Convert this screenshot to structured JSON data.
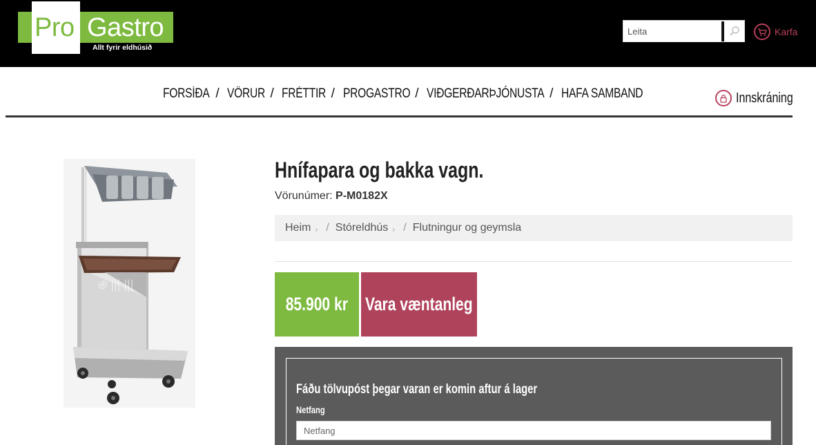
{
  "header": {
    "logo": {
      "pro": "Pro",
      "gastro": "Gastro",
      "tagline": "Allt fyrir eldhúsið"
    },
    "search": {
      "placeholder": "Leita",
      "value": ""
    },
    "cart_label": "Karfa"
  },
  "nav": {
    "items": [
      "FORSÍÐA",
      "VÖRUR",
      "FRÉTTIR",
      "PROGASTRO",
      "VIÐGERÐARÞJÓNUSTA",
      "HAFA SAMBAND"
    ],
    "separator": "/",
    "login_label": "Innskráning"
  },
  "product": {
    "title": "Hnífapara og bakka vagn.",
    "sku_label": "Vörunúmer:",
    "sku_value": "P-M0182X",
    "breadcrumb": [
      "Heim",
      "Stóreldhús",
      "Flutningur og geymsla"
    ],
    "price": "85.900 kr",
    "availability": "Vara væntanleg"
  },
  "notify": {
    "heading": "Fáðu tölvupóst þegar varan er komin aftur á lager",
    "email_label": "Netfang",
    "email_placeholder": "Netfang"
  },
  "colors": {
    "brand_green": "#7dba3f",
    "brand_red": "#b0435c",
    "header_bg": "#000000",
    "notify_bg": "#5b5b5b"
  }
}
